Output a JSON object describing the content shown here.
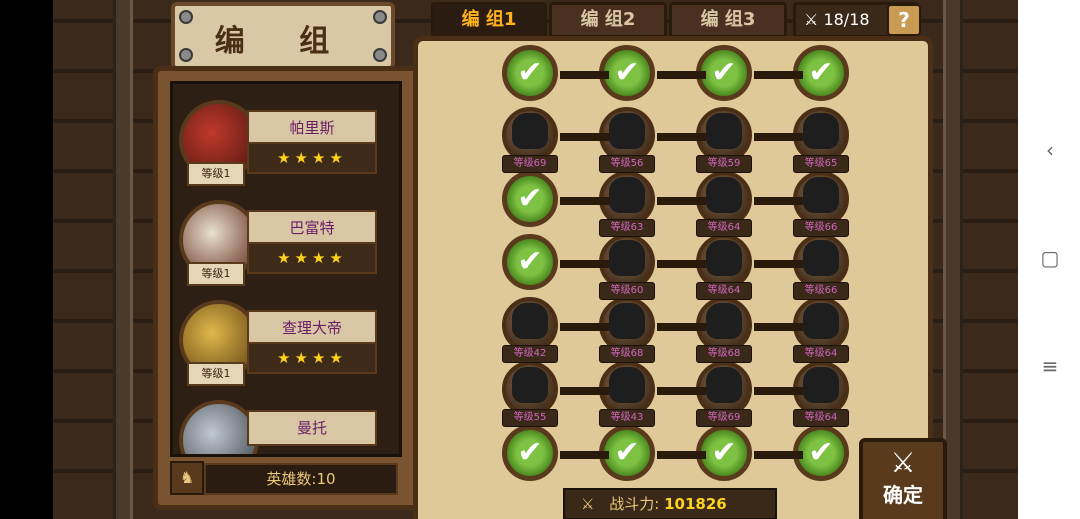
{
  "title": "编 组",
  "tabs": [
    {
      "label": "编 组1",
      "active": true
    },
    {
      "label": "编 组2",
      "active": false
    },
    {
      "label": "编 组3",
      "active": false
    }
  ],
  "unit_count": "18/18",
  "help_label": "?",
  "heroes": [
    {
      "name": "帕里斯",
      "level": "等级1",
      "stars": "★★★★"
    },
    {
      "name": "巴富特",
      "level": "等级1",
      "stars": "★★★★"
    },
    {
      "name": "查理大帝",
      "level": "等级1",
      "stars": "★★★★"
    },
    {
      "name": "曼托",
      "level": "",
      "stars": ""
    }
  ],
  "hero_count": "英雄数:10",
  "formation": [
    [
      "check",
      "check",
      "check",
      "check"
    ],
    [
      "等级69",
      "等级56",
      "等级59",
      "等级65"
    ],
    [
      "check",
      "等级63",
      "等级64",
      "等级66"
    ],
    [
      "check",
      "等级60",
      "等级64",
      "等级66"
    ],
    [
      "等级42",
      "等级68",
      "等级68",
      "等级64"
    ],
    [
      "等级55",
      "等级43",
      "等级69",
      "等级64"
    ],
    [
      "check",
      "check",
      "check",
      "check"
    ]
  ],
  "power_label": "战斗力:",
  "power_value": "101826",
  "confirm_label": "确定",
  "colors": {
    "accent": "#ffb21c",
    "level": "#d066c0",
    "check": "#7ec243"
  }
}
